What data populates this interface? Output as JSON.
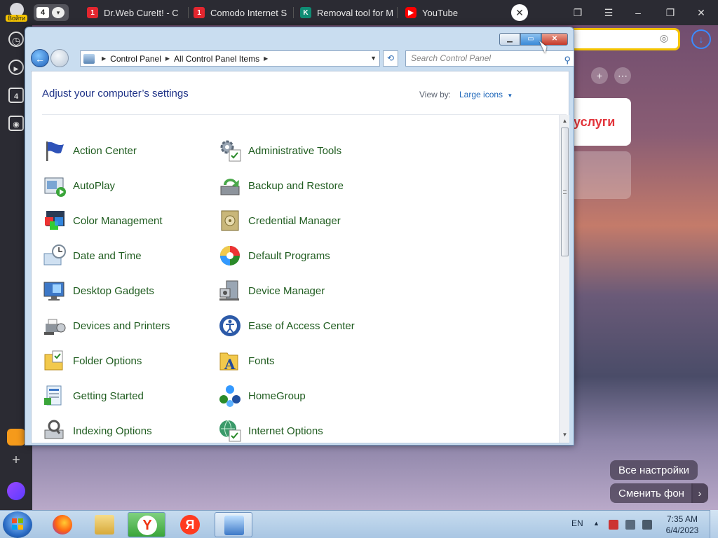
{
  "browser": {
    "login_label": "Войти",
    "tab_count": "4",
    "tabs": [
      {
        "title": "Dr.Web CureIt! - C",
        "icon": "drweb-icon",
        "color": "#e3262f"
      },
      {
        "title": "Comodo Internet S",
        "icon": "drweb-icon",
        "color": "#e3262f"
      },
      {
        "title": "Removal tool for M",
        "icon": "kaspersky-icon",
        "color": "#0f8c74"
      },
      {
        "title": "YouTube",
        "icon": "youtube-icon",
        "color": "#ff0000"
      }
    ],
    "sidebar_badge": "4",
    "tile_label": "услуги",
    "all_settings": "Все настройки",
    "change_bg": "Сменить фон"
  },
  "window": {
    "breadcrumbs": [
      "Control Panel",
      "All Control Panel Items"
    ],
    "search_placeholder": "Search Control Panel",
    "page_title": "Adjust your computer’s settings",
    "view_by_label": "View by:",
    "view_by_value": "Large icons",
    "items": [
      {
        "label": "Action Center",
        "icon": "flag-icon"
      },
      {
        "label": "Administrative Tools",
        "icon": "gears-icon"
      },
      {
        "label": "AutoPlay",
        "icon": "autoplay-icon"
      },
      {
        "label": "Backup and Restore",
        "icon": "backup-icon"
      },
      {
        "label": "Color Management",
        "icon": "color-icon"
      },
      {
        "label": "Credential Manager",
        "icon": "vault-icon"
      },
      {
        "label": "Date and Time",
        "icon": "clock-icon"
      },
      {
        "label": "Default Programs",
        "icon": "default-programs-icon"
      },
      {
        "label": "Desktop Gadgets",
        "icon": "gadgets-icon"
      },
      {
        "label": "Device Manager",
        "icon": "device-manager-icon"
      },
      {
        "label": "Devices and Printers",
        "icon": "printer-icon"
      },
      {
        "label": "Ease of Access Center",
        "icon": "ease-of-access-icon"
      },
      {
        "label": "Folder Options",
        "icon": "folder-icon"
      },
      {
        "label": "Fonts",
        "icon": "fonts-icon"
      },
      {
        "label": "Getting Started",
        "icon": "getting-started-icon"
      },
      {
        "label": "HomeGroup",
        "icon": "homegroup-icon"
      },
      {
        "label": "Indexing Options",
        "icon": "indexing-icon"
      },
      {
        "label": "Internet Options",
        "icon": "internet-options-icon"
      }
    ]
  },
  "taskbar": {
    "lang": "EN",
    "time": "7:35 AM",
    "date": "6/4/2023"
  }
}
